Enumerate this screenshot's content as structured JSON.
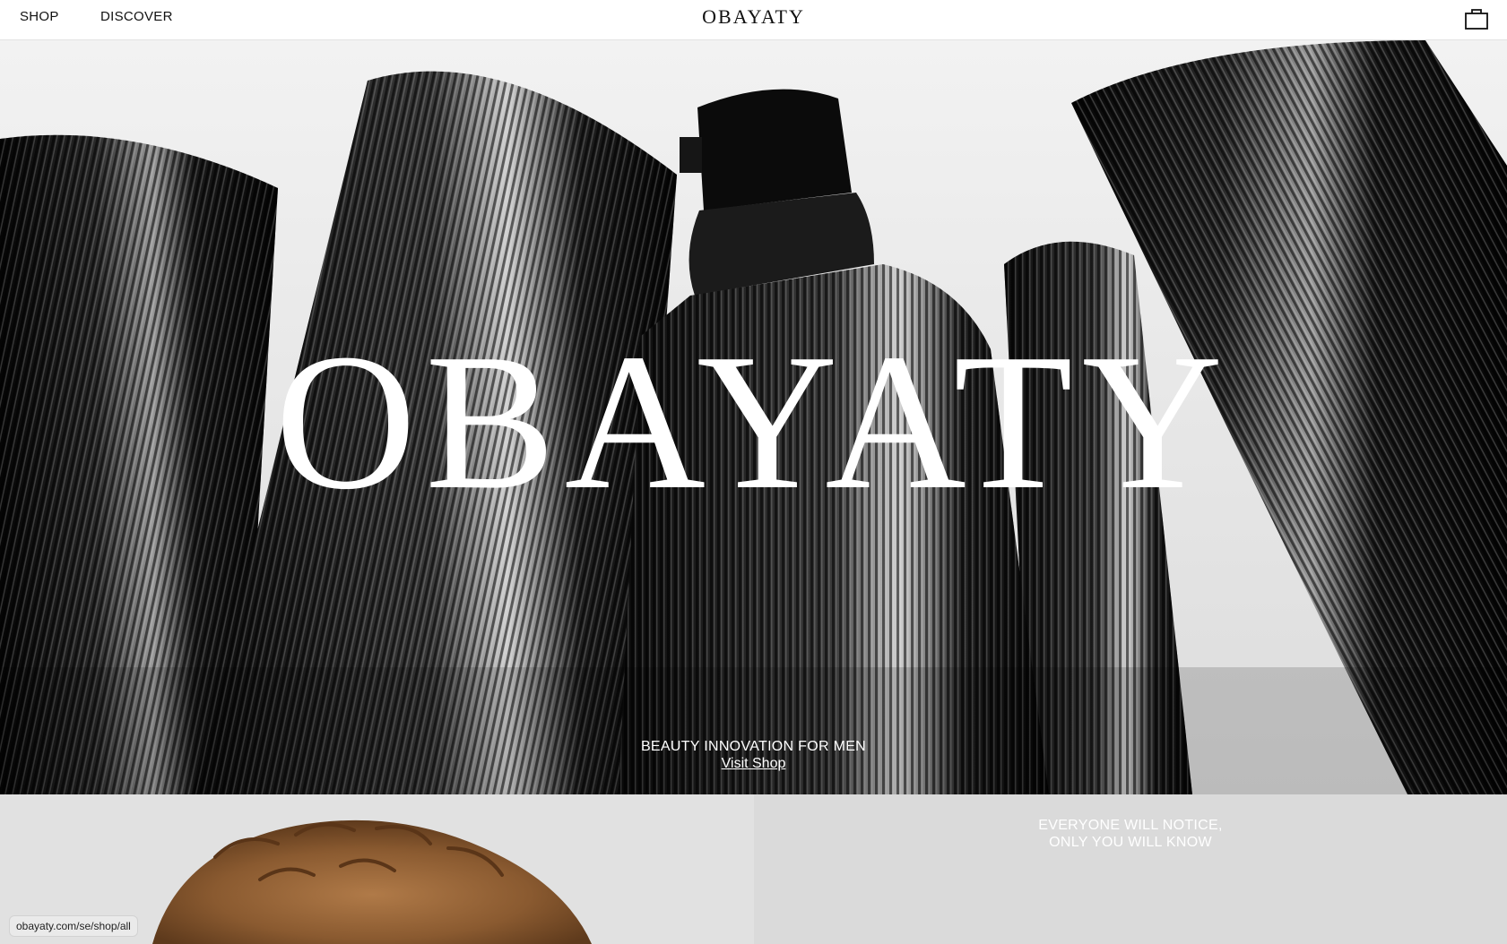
{
  "header": {
    "nav": [
      {
        "label": "SHOP"
      },
      {
        "label": "DISCOVER"
      }
    ],
    "logo": "OBAYATY",
    "cart_icon": "shopping-bag-icon"
  },
  "hero": {
    "title": "OBAYATY",
    "tagline": "BEAUTY INNOVATION FOR MEN",
    "cta_label": "Visit Shop",
    "image": "ribbed-black-cosmetic-bottles"
  },
  "promo": {
    "left_image": "man-curly-hair-portrait",
    "heading_line1": "EVERYONE WILL NOTICE,",
    "heading_line2": "ONLY YOU WILL KNOW"
  },
  "status_bar": {
    "url": "obayaty.com/se/shop/all"
  },
  "colors": {
    "header_bg": "#ffffff",
    "text_dark": "#111111",
    "hero_text": "#ffffff",
    "panel_left_bg": "#e1e1e1",
    "panel_right_bg": "#dadada"
  }
}
